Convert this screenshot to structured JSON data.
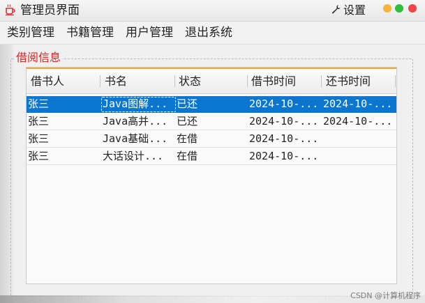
{
  "window": {
    "title": "管理员界面",
    "settings_label": "设置",
    "icon": "coffee-cup-icon",
    "controls_colors": {
      "minimize": "#f5b53b",
      "maximize": "#2fbf3a",
      "close": "#ee4444"
    }
  },
  "menu": {
    "items": [
      {
        "label": "类别管理"
      },
      {
        "label": "书籍管理"
      },
      {
        "label": "用户管理"
      },
      {
        "label": "退出系统"
      }
    ]
  },
  "panel": {
    "legend": "借阅信息",
    "legend_color": "#e02020"
  },
  "table": {
    "header_accent": "#f0a830",
    "selection_color": "#0a76d0",
    "columns": [
      "借书人",
      "书名",
      "状态",
      "借书时间",
      "还书时间"
    ],
    "rows": [
      {
        "borrower": "张三",
        "book": "Java图解...",
        "status": "已还",
        "borrow_time": "2024-10-...",
        "return_time": "2024-10-...",
        "selected": true
      },
      {
        "borrower": "张三",
        "book": "Java高并...",
        "status": "已还",
        "borrow_time": "2024-10-...",
        "return_time": "2024-10-...",
        "selected": false
      },
      {
        "borrower": "张三",
        "book": "Java基础...",
        "status": "在借",
        "borrow_time": "2024-10-...",
        "return_time": "",
        "selected": false
      },
      {
        "borrower": "张三",
        "book": "大话设计...",
        "status": "在借",
        "borrow_time": "2024-10-...",
        "return_time": "",
        "selected": false
      }
    ]
  },
  "watermark": "CSDN @计算机程序"
}
